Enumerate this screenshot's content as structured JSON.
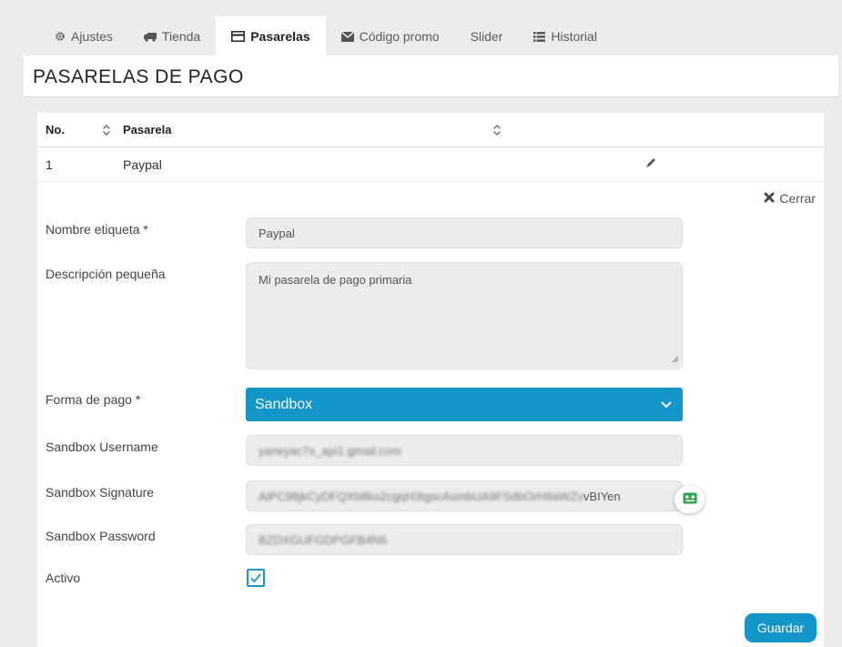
{
  "tabs": [
    {
      "label": "Ajustes",
      "icon": "gear-icon"
    },
    {
      "label": "Tienda",
      "icon": "truck-icon"
    },
    {
      "label": "Pasarelas",
      "icon": "credit-card-icon",
      "active": true
    },
    {
      "label": "Código promo",
      "icon": "envelope-icon"
    },
    {
      "label": "Slider",
      "icon": ""
    },
    {
      "label": "Historial",
      "icon": "list-icon"
    }
  ],
  "page": {
    "title": "PASARELAS DE PAGO"
  },
  "table": {
    "headers": {
      "no": "No.",
      "pasarela": "Pasarela"
    },
    "rows": [
      {
        "no": "1",
        "pasarela": "Paypal"
      }
    ]
  },
  "form": {
    "close_label": "Cerrar",
    "nombre_label": "Nombre etiqueta *",
    "nombre_value": "Paypal",
    "descripcion_label": "Descripción pequeña",
    "descripcion_value": "Mi pasarela de pago primaria",
    "forma_label": "Forma de pago *",
    "forma_value": "Sandbox",
    "username_label": "Sandbox Username",
    "username_value": "yaneyac7s_api1.gmail.com",
    "signature_label": "Sandbox Signature",
    "signature_value_blurred": "AiPC98jkCyDFQXb8ko2cgqH3tgscAsmbUA9FSdbOrH9aWZv",
    "signature_value_visible": "vBIYen",
    "password_label": "Sandbox Password",
    "password_value": "BZDXGUFGDPGFB4N6",
    "activo_label": "Activo",
    "activo_checked": true,
    "save_label": "Guardar"
  },
  "colors": {
    "accent": "#1596c8",
    "badge_green": "#2aa14a"
  }
}
